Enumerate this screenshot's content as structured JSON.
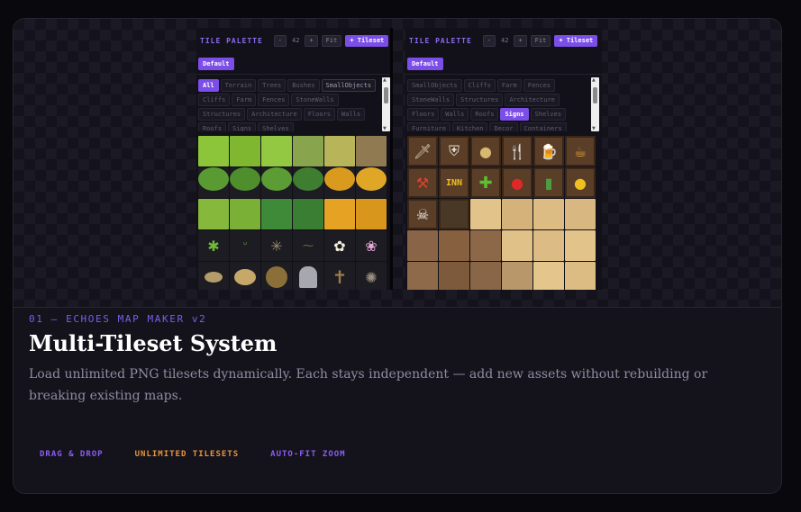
{
  "card": {
    "eyebrow": "01 — ECHOES MAP MAKER v2",
    "title": "Multi-Tileset System",
    "description": "Load unlimited PNG tilesets dynamically. Each stays independent — add new assets without rebuilding or breaking existing maps.",
    "tags": [
      {
        "label": "DRAG & DROP",
        "color": "#8b5cf6"
      },
      {
        "label": "UNLIMITED TILESETS",
        "color": "#e8933a"
      },
      {
        "label": "AUTO-FIT ZOOM",
        "color": "#8b5cf6"
      }
    ]
  },
  "palettes": [
    {
      "title": "TILE PALETTE",
      "zoom_out": "-",
      "zoom_value": "42",
      "zoom_in": "+",
      "fit": "Fit",
      "add_tileset": "+ Tileset",
      "tileset": "Default",
      "categories": [
        "All",
        "Terrain",
        "Trees",
        "Bushes",
        "SmallObjects",
        "Cliffs",
        "Farm",
        "Fences",
        "StoneWalls",
        "Structures",
        "Architecture",
        "Floors",
        "Walls",
        "Roofs",
        "Signs",
        "Shelves"
      ],
      "active_category": "All",
      "tile_icons": [
        "grass-tile",
        "grass-tile",
        "grass-tile",
        "grass-tile",
        "grass-tile",
        "dirt-tile",
        "tree-icon",
        "tree-icon",
        "tree-icon",
        "tree-icon",
        "tree-icon",
        "tree-icon",
        "bush-tile",
        "bush-tile",
        "bush-tile",
        "bush-tile",
        "bush-tile",
        "bush-tile",
        "plant-icon",
        "sprout-icon",
        "spider-icon",
        "weed-icon",
        "flower-icon",
        "flower-icon",
        "rock-icon",
        "rock-icon",
        "stump-icon",
        "gravestone-icon",
        "cross-icon",
        "web-icon"
      ]
    },
    {
      "title": "TILE PALETTE",
      "zoom_out": "-",
      "zoom_value": "42",
      "zoom_in": "+",
      "fit": "Fit",
      "add_tileset": "+ Tileset",
      "tileset": "Default",
      "categories": [
        "SmallObjects",
        "Cliffs",
        "Farm",
        "Fences",
        "StoneWalls",
        "Structures",
        "Architecture",
        "Floors",
        "Walls",
        "Roofs",
        "Signs",
        "Shelves",
        "Furniture",
        "Kitchen",
        "Decor",
        "Containers"
      ],
      "active_category": "Signs",
      "sign_text": "INN",
      "tile_icons": [
        "sword-sign-icon",
        "shield-sign-icon",
        "bread-sign-icon",
        "fork-knife-sign-icon",
        "beer-sign-icon",
        "teapot-sign-icon",
        "hammer-sign-icon",
        "inn-sign",
        "cross-sign-icon",
        "apple-sign-icon",
        "potion-sign-icon",
        "coin-sign-icon",
        "skull-sign-icon",
        "blank-sign",
        "wood-floor-tile",
        "wood-floor-tile",
        "wood-floor-tile",
        "wood-floor-tile",
        "wood-floor-tile",
        "wood-floor-tile",
        "wood-floor-tile",
        "wood-floor-tile",
        "wood-floor-tile",
        "wood-floor-tile",
        "wood-floor-tile",
        "wood-floor-tile",
        "wood-floor-tile",
        "wood-floor-tile",
        "wood-floor-tile",
        "wood-floor-tile"
      ]
    }
  ]
}
